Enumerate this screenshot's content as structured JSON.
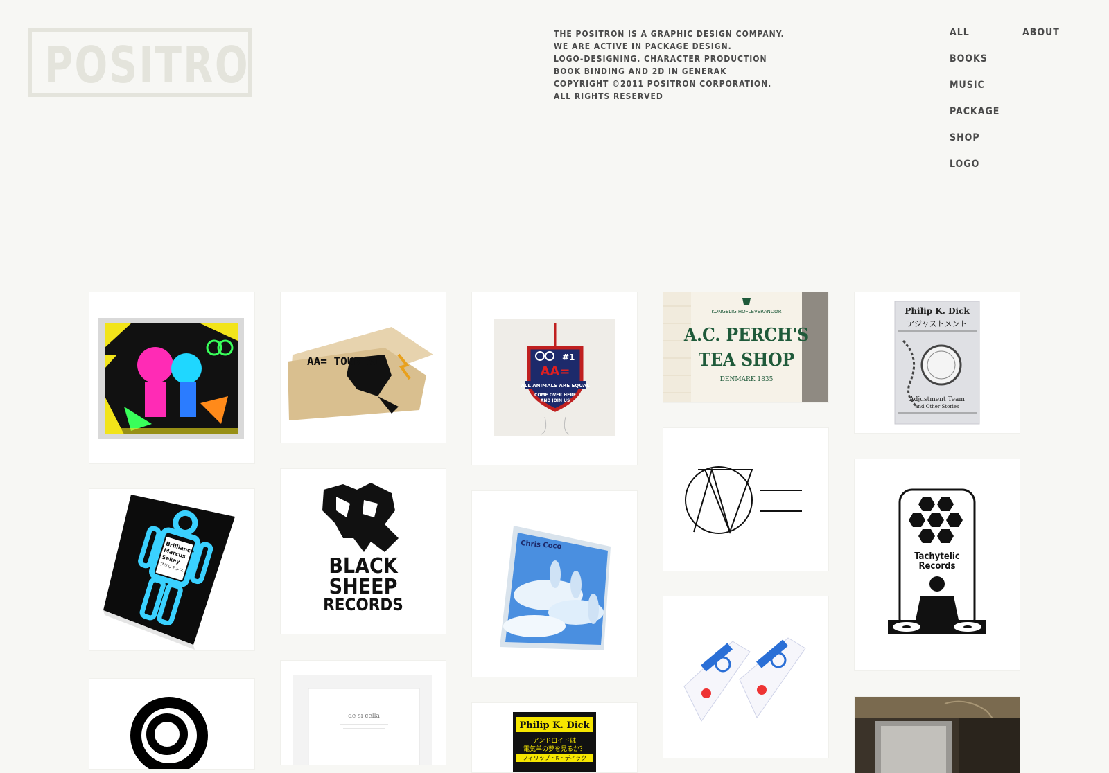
{
  "brand": {
    "logo_text": "POSITRON"
  },
  "about_lines": [
    "THE POSITRON IS A GRAPHIC DESIGN COMPANY.",
    "WE ARE ACTIVE IN PACKAGE DESIGN.",
    "LOGO-DESIGNING. CHARACTER PRODUCTION",
    "BOOK BINDING AND 2D IN GENERAK",
    "COPYRIGHT ©2011 POSITRON CORPORATION.",
    "ALL RIGHTS RESERVED"
  ],
  "nav": {
    "items": [
      "ALL",
      "BOOKS",
      "MUSIC",
      "PACKAGE",
      "SHOP",
      "LOGO"
    ],
    "about": "ABOUT"
  },
  "tiles": {
    "aae_tour": "AA= TOUR #1",
    "aae_badge_top": "AA=",
    "aae_badge_line1": "ALL ANIMALS ARE EQUAL",
    "aae_badge_line2": "COME OVER HERE",
    "aae_badge_line3": "AND JOIN US",
    "tea_line0": "KONGELIG HOFLEVERANDØR",
    "tea_line1": "A.C. PERCH'S",
    "tea_line2": "TEA SHOP",
    "tea_line3": "DENMARK 1835",
    "pkd1_author": "Philip K. Dick",
    "pkd1_title_jp": "アジャストメント",
    "pkd1_en1": "Adjustment Team",
    "pkd1_en2": "and Other Stories",
    "bm_line1": "Brilliance",
    "bm_line2": "Marcus",
    "bm_line3": "Sakey",
    "bm_jp": "ブリリアンス",
    "bsr_line1": "BLACK",
    "bsr_line2": "SHEEP",
    "bsr_line3": "RECORDS",
    "cc_artist": "Chris Coco",
    "tachy_line1": "Tachytelic",
    "tachy_line2": "Records",
    "card_text": "de si cella",
    "pkd2_author": "Philip K. Dick",
    "pkd2_jp1": "アンドロイドは",
    "pkd2_jp2": "電気羊の夢を見るか？",
    "pkd2_jp3": "フィリップ・K・ディック"
  },
  "colors": {
    "background": "#f7f7f4",
    "logo": "#e4e4dc",
    "text": "#4a4a4a",
    "tea_green": "#1f5a3a",
    "navy": "#1d2a6b",
    "cyan": "#1fb3ff"
  }
}
